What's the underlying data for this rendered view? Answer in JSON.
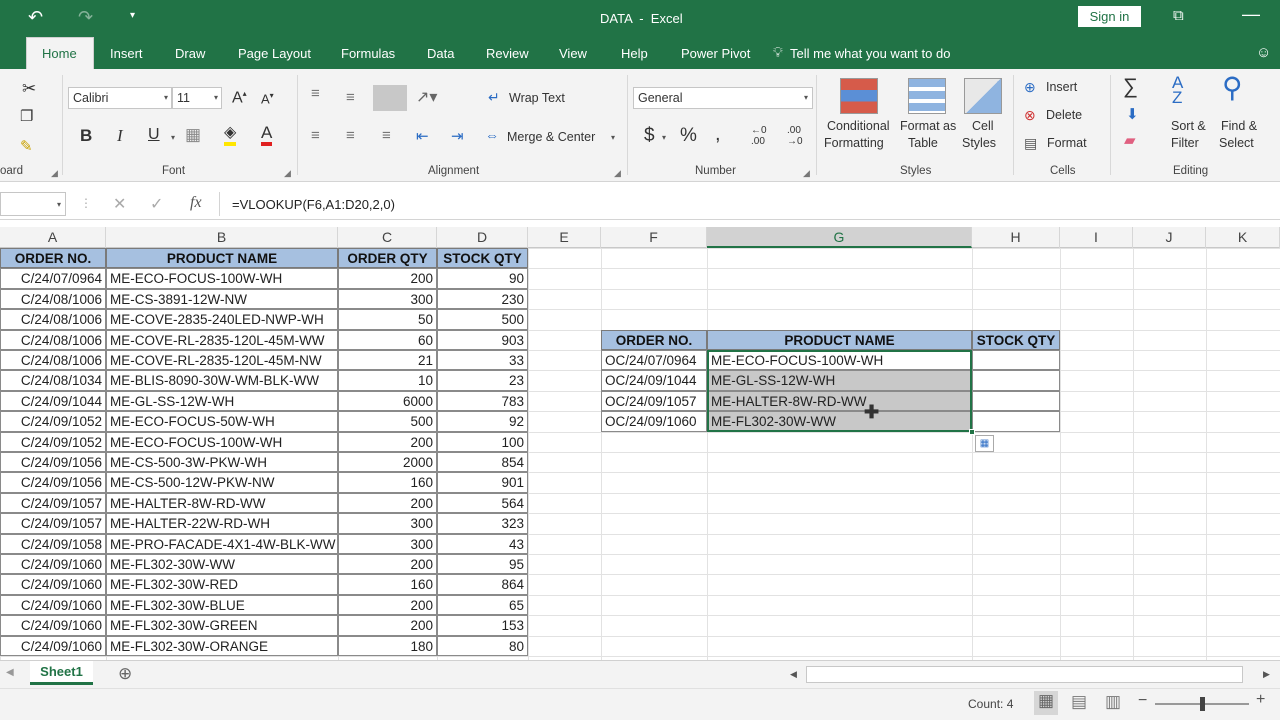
{
  "window": {
    "title": "DATA  -  Excel",
    "sign_in": "Sign in"
  },
  "tabs": [
    "Home",
    "Insert",
    "Draw",
    "Page Layout",
    "Formulas",
    "Data",
    "Review",
    "View",
    "Help",
    "Power Pivot"
  ],
  "tell_me": "Tell me what you want to do",
  "ribbon": {
    "clipboard_label": "oard",
    "font_name": "Calibri",
    "font_size": "11",
    "font_label": "Font",
    "wrap_text": "Wrap Text",
    "merge_center": "Merge & Center",
    "alignment_label": "Alignment",
    "number_format": "General",
    "number_label": "Number",
    "currency": "$",
    "percent": "%",
    "conditional_formatting_1": "Conditional",
    "conditional_formatting_2": "Formatting",
    "format_as_table_1": "Format as",
    "format_as_table_2": "Table",
    "cell_styles_1": "Cell",
    "cell_styles_2": "Styles",
    "styles_label": "Styles",
    "insert": "Insert",
    "delete": "Delete",
    "format": "Format",
    "cells_label": "Cells",
    "sort_filter_1": "Sort &",
    "sort_filter_2": "Filter",
    "find_select_1": "Find &",
    "find_select_2": "Select",
    "editing_label": "Editing"
  },
  "formula_bar": {
    "fx": "fx",
    "formula": "=VLOOKUP(F6,A1:D20,2,0)"
  },
  "columns": [
    "A",
    "B",
    "C",
    "D",
    "E",
    "F",
    "G",
    "H",
    "I",
    "J",
    "K"
  ],
  "main_table": {
    "headers": [
      "ORDER NO.",
      "PRODUCT NAME",
      "ORDER QTY",
      "STOCK QTY"
    ],
    "rows": [
      [
        "C/24/07/0964",
        "ME-ECO-FOCUS-100W-WH",
        "200",
        "90"
      ],
      [
        "C/24/08/1006",
        "ME-CS-3891-12W-NW",
        "300",
        "230"
      ],
      [
        "C/24/08/1006",
        "ME-COVE-2835-240LED-NWP-WH",
        "50",
        "500"
      ],
      [
        "C/24/08/1006",
        "ME-COVE-RL-2835-120L-45M-WW",
        "60",
        "903"
      ],
      [
        "C/24/08/1006",
        "ME-COVE-RL-2835-120L-45M-NW",
        "21",
        "33"
      ],
      [
        "C/24/08/1034",
        "ME-BLIS-8090-30W-WM-BLK-WW",
        "10",
        "23"
      ],
      [
        "C/24/09/1044",
        "ME-GL-SS-12W-WH",
        "6000",
        "783"
      ],
      [
        "C/24/09/1052",
        "ME-ECO-FOCUS-50W-WH",
        "500",
        "92"
      ],
      [
        "C/24/09/1052",
        "ME-ECO-FOCUS-100W-WH",
        "200",
        "100"
      ],
      [
        "C/24/09/1056",
        "ME-CS-500-3W-PKW-WH",
        "2000",
        "854"
      ],
      [
        "C/24/09/1056",
        "ME-CS-500-12W-PKW-NW",
        "160",
        "901"
      ],
      [
        "C/24/09/1057",
        "ME-HALTER-8W-RD-WW",
        "200",
        "564"
      ],
      [
        "C/24/09/1057",
        "ME-HALTER-22W-RD-WH",
        "300",
        "323"
      ],
      [
        "C/24/09/1058",
        "ME-PRO-FACADE-4X1-4W-BLK-WW",
        "300",
        "43"
      ],
      [
        "C/24/09/1060",
        "ME-FL302-30W-WW",
        "200",
        "95"
      ],
      [
        "C/24/09/1060",
        "ME-FL302-30W-RED",
        "160",
        "864"
      ],
      [
        "C/24/09/1060",
        "ME-FL302-30W-BLUE",
        "200",
        "65"
      ],
      [
        "C/24/09/1060",
        "ME-FL302-30W-GREEN",
        "200",
        "153"
      ],
      [
        "C/24/09/1060",
        "ME-FL302-30W-ORANGE",
        "180",
        "80"
      ]
    ]
  },
  "lookup_table": {
    "headers": [
      "ORDER NO.",
      "PRODUCT NAME",
      "STOCK QTY"
    ],
    "rows": [
      [
        "OC/24/07/0964",
        "ME-ECO-FOCUS-100W-WH",
        ""
      ],
      [
        "OC/24/09/1044",
        "ME-GL-SS-12W-WH",
        ""
      ],
      [
        "OC/24/09/1057",
        "ME-HALTER-8W-RD-WW",
        ""
      ],
      [
        "OC/24/09/1060",
        "ME-FL302-30W-WW",
        ""
      ]
    ]
  },
  "sheet_tab": "Sheet1",
  "status": {
    "count": "Count: 4"
  },
  "colors": {
    "excel_green": "#217346",
    "header_fill": "#a6c0e0",
    "selection": "#c8c8c8"
  }
}
